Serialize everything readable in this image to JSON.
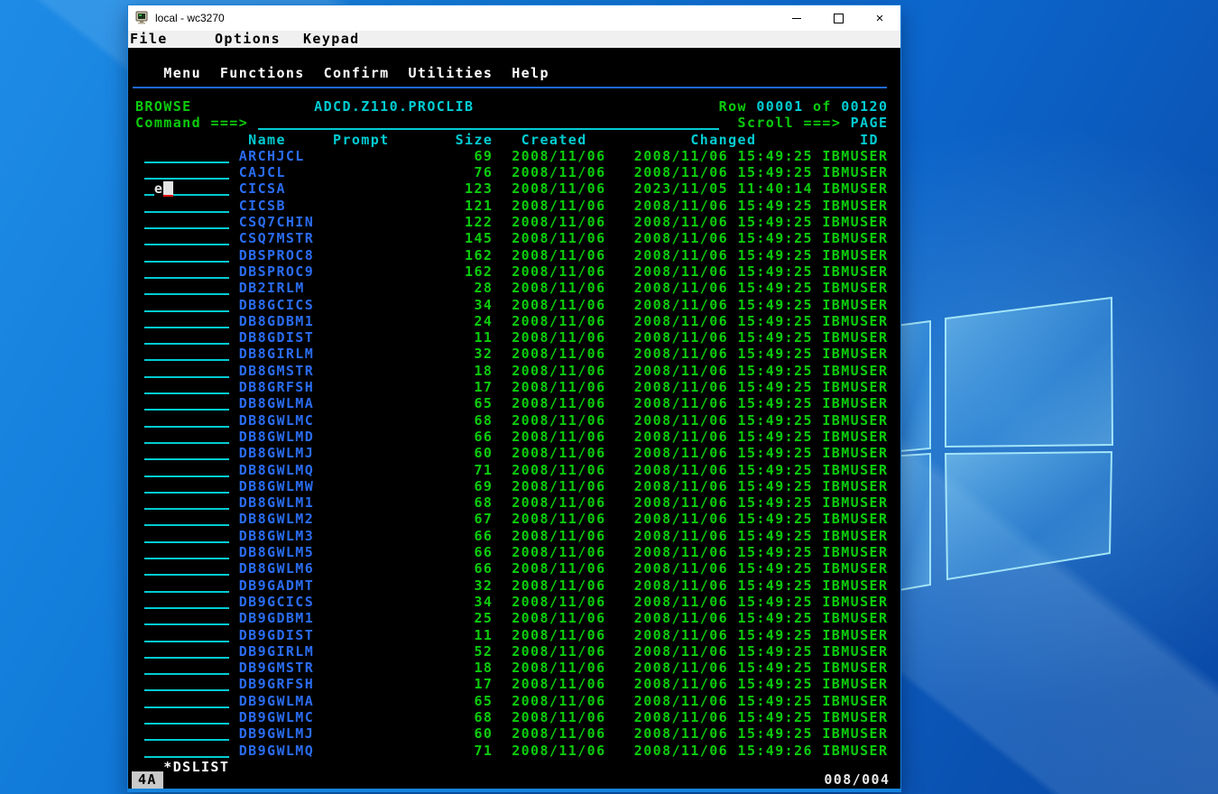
{
  "window": {
    "title": "local - wc3270",
    "controls": {
      "minimize": "–",
      "maximize": "☐",
      "close": "×"
    }
  },
  "menubar": {
    "items": [
      "File",
      "Options",
      "Keypad"
    ]
  },
  "terminal": {
    "action_bar": [
      "Menu",
      "Functions",
      "Confirm",
      "Utilities",
      "Help"
    ],
    "panel": {
      "mode": "BROWSE",
      "dataset": "ADCD.Z110.PROCLIB",
      "row_label": "Row",
      "row_first": "00001",
      "of_label": "of",
      "row_total": "00120",
      "command_label": "Command ===>",
      "command_value": "",
      "scroll_label": "Scroll ===>",
      "scroll_value": "PAGE"
    },
    "columns": [
      "Name",
      "Prompt",
      "Size",
      "Created",
      "Changed",
      "ID"
    ],
    "cursor": {
      "member_index": 2,
      "typed": "e"
    },
    "members": [
      {
        "sel": "",
        "name": "ARCHJCL",
        "prompt": "",
        "size": "69",
        "created": "2008/11/06",
        "changed": "2008/11/06 15:49:25",
        "id": "IBMUSER"
      },
      {
        "sel": "",
        "name": "CAJCL",
        "prompt": "",
        "size": "76",
        "created": "2008/11/06",
        "changed": "2008/11/06 15:49:25",
        "id": "IBMUSER"
      },
      {
        "sel": "e",
        "name": "CICSA",
        "prompt": "",
        "size": "123",
        "created": "2008/11/06",
        "changed": "2023/11/05 11:40:14",
        "id": "IBMUSER"
      },
      {
        "sel": "",
        "name": "CICSB",
        "prompt": "",
        "size": "121",
        "created": "2008/11/06",
        "changed": "2008/11/06 15:49:25",
        "id": "IBMUSER"
      },
      {
        "sel": "",
        "name": "CSQ7CHIN",
        "prompt": "",
        "size": "122",
        "created": "2008/11/06",
        "changed": "2008/11/06 15:49:25",
        "id": "IBMUSER"
      },
      {
        "sel": "",
        "name": "CSQ7MSTR",
        "prompt": "",
        "size": "145",
        "created": "2008/11/06",
        "changed": "2008/11/06 15:49:25",
        "id": "IBMUSER"
      },
      {
        "sel": "",
        "name": "DBSPROC8",
        "prompt": "",
        "size": "162",
        "created": "2008/11/06",
        "changed": "2008/11/06 15:49:25",
        "id": "IBMUSER"
      },
      {
        "sel": "",
        "name": "DBSPROC9",
        "prompt": "",
        "size": "162",
        "created": "2008/11/06",
        "changed": "2008/11/06 15:49:25",
        "id": "IBMUSER"
      },
      {
        "sel": "",
        "name": "DB2IRLM",
        "prompt": "",
        "size": "28",
        "created": "2008/11/06",
        "changed": "2008/11/06 15:49:25",
        "id": "IBMUSER"
      },
      {
        "sel": "",
        "name": "DB8GCICS",
        "prompt": "",
        "size": "34",
        "created": "2008/11/06",
        "changed": "2008/11/06 15:49:25",
        "id": "IBMUSER"
      },
      {
        "sel": "",
        "name": "DB8GDBM1",
        "prompt": "",
        "size": "24",
        "created": "2008/11/06",
        "changed": "2008/11/06 15:49:25",
        "id": "IBMUSER"
      },
      {
        "sel": "",
        "name": "DB8GDIST",
        "prompt": "",
        "size": "11",
        "created": "2008/11/06",
        "changed": "2008/11/06 15:49:25",
        "id": "IBMUSER"
      },
      {
        "sel": "",
        "name": "DB8GIRLM",
        "prompt": "",
        "size": "32",
        "created": "2008/11/06",
        "changed": "2008/11/06 15:49:25",
        "id": "IBMUSER"
      },
      {
        "sel": "",
        "name": "DB8GMSTR",
        "prompt": "",
        "size": "18",
        "created": "2008/11/06",
        "changed": "2008/11/06 15:49:25",
        "id": "IBMUSER"
      },
      {
        "sel": "",
        "name": "DB8GRFSH",
        "prompt": "",
        "size": "17",
        "created": "2008/11/06",
        "changed": "2008/11/06 15:49:25",
        "id": "IBMUSER"
      },
      {
        "sel": "",
        "name": "DB8GWLMA",
        "prompt": "",
        "size": "65",
        "created": "2008/11/06",
        "changed": "2008/11/06 15:49:25",
        "id": "IBMUSER"
      },
      {
        "sel": "",
        "name": "DB8GWLMC",
        "prompt": "",
        "size": "68",
        "created": "2008/11/06",
        "changed": "2008/11/06 15:49:25",
        "id": "IBMUSER"
      },
      {
        "sel": "",
        "name": "DB8GWLMD",
        "prompt": "",
        "size": "66",
        "created": "2008/11/06",
        "changed": "2008/11/06 15:49:25",
        "id": "IBMUSER"
      },
      {
        "sel": "",
        "name": "DB8GWLMJ",
        "prompt": "",
        "size": "60",
        "created": "2008/11/06",
        "changed": "2008/11/06 15:49:25",
        "id": "IBMUSER"
      },
      {
        "sel": "",
        "name": "DB8GWLMQ",
        "prompt": "",
        "size": "71",
        "created": "2008/11/06",
        "changed": "2008/11/06 15:49:25",
        "id": "IBMUSER"
      },
      {
        "sel": "",
        "name": "DB8GWLMW",
        "prompt": "",
        "size": "69",
        "created": "2008/11/06",
        "changed": "2008/11/06 15:49:25",
        "id": "IBMUSER"
      },
      {
        "sel": "",
        "name": "DB8GWLM1",
        "prompt": "",
        "size": "68",
        "created": "2008/11/06",
        "changed": "2008/11/06 15:49:25",
        "id": "IBMUSER"
      },
      {
        "sel": "",
        "name": "DB8GWLM2",
        "prompt": "",
        "size": "67",
        "created": "2008/11/06",
        "changed": "2008/11/06 15:49:25",
        "id": "IBMUSER"
      },
      {
        "sel": "",
        "name": "DB8GWLM3",
        "prompt": "",
        "size": "66",
        "created": "2008/11/06",
        "changed": "2008/11/06 15:49:25",
        "id": "IBMUSER"
      },
      {
        "sel": "",
        "name": "DB8GWLM5",
        "prompt": "",
        "size": "66",
        "created": "2008/11/06",
        "changed": "2008/11/06 15:49:25",
        "id": "IBMUSER"
      },
      {
        "sel": "",
        "name": "DB8GWLM6",
        "prompt": "",
        "size": "66",
        "created": "2008/11/06",
        "changed": "2008/11/06 15:49:25",
        "id": "IBMUSER"
      },
      {
        "sel": "",
        "name": "DB9GADMT",
        "prompt": "",
        "size": "32",
        "created": "2008/11/06",
        "changed": "2008/11/06 15:49:25",
        "id": "IBMUSER"
      },
      {
        "sel": "",
        "name": "DB9GCICS",
        "prompt": "",
        "size": "34",
        "created": "2008/11/06",
        "changed": "2008/11/06 15:49:25",
        "id": "IBMUSER"
      },
      {
        "sel": "",
        "name": "DB9GDBM1",
        "prompt": "",
        "size": "25",
        "created": "2008/11/06",
        "changed": "2008/11/06 15:49:25",
        "id": "IBMUSER"
      },
      {
        "sel": "",
        "name": "DB9GDIST",
        "prompt": "",
        "size": "11",
        "created": "2008/11/06",
        "changed": "2008/11/06 15:49:25",
        "id": "IBMUSER"
      },
      {
        "sel": "",
        "name": "DB9GIRLM",
        "prompt": "",
        "size": "52",
        "created": "2008/11/06",
        "changed": "2008/11/06 15:49:25",
        "id": "IBMUSER"
      },
      {
        "sel": "",
        "name": "DB9GMSTR",
        "prompt": "",
        "size": "18",
        "created": "2008/11/06",
        "changed": "2008/11/06 15:49:25",
        "id": "IBMUSER"
      },
      {
        "sel": "",
        "name": "DB9GRFSH",
        "prompt": "",
        "size": "17",
        "created": "2008/11/06",
        "changed": "2008/11/06 15:49:25",
        "id": "IBMUSER"
      },
      {
        "sel": "",
        "name": "DB9GWLMA",
        "prompt": "",
        "size": "65",
        "created": "2008/11/06",
        "changed": "2008/11/06 15:49:25",
        "id": "IBMUSER"
      },
      {
        "sel": "",
        "name": "DB9GWLMC",
        "prompt": "",
        "size": "68",
        "created": "2008/11/06",
        "changed": "2008/11/06 15:49:25",
        "id": "IBMUSER"
      },
      {
        "sel": "",
        "name": "DB9GWLMJ",
        "prompt": "",
        "size": "60",
        "created": "2008/11/06",
        "changed": "2008/11/06 15:49:25",
        "id": "IBMUSER"
      },
      {
        "sel": "",
        "name": "DB9GWLMQ",
        "prompt": "",
        "size": "71",
        "created": "2008/11/06",
        "changed": "2008/11/06 15:49:26",
        "id": "IBMUSER"
      }
    ],
    "footer": "*DSLIST",
    "oia": {
      "status": "4A",
      "cursor_position": "008/004"
    }
  },
  "colors": {
    "terminal_green": "#0ccc0c",
    "terminal_cyan": "#00ccd2",
    "terminal_blue": "#2a6cf0",
    "terminal_white": "#ffffff",
    "divider_blue": "#1e6ad8",
    "cursor_block": "#e4e4e4",
    "cursor_underline_red": "#e01010",
    "oia_badge_bg": "#c9c9c9",
    "titlebar_bg": "#ffffff",
    "menubar_bg": "#f0f0f0",
    "window_border": "#1a80d8",
    "desktop_blue": "#0c66cc"
  }
}
